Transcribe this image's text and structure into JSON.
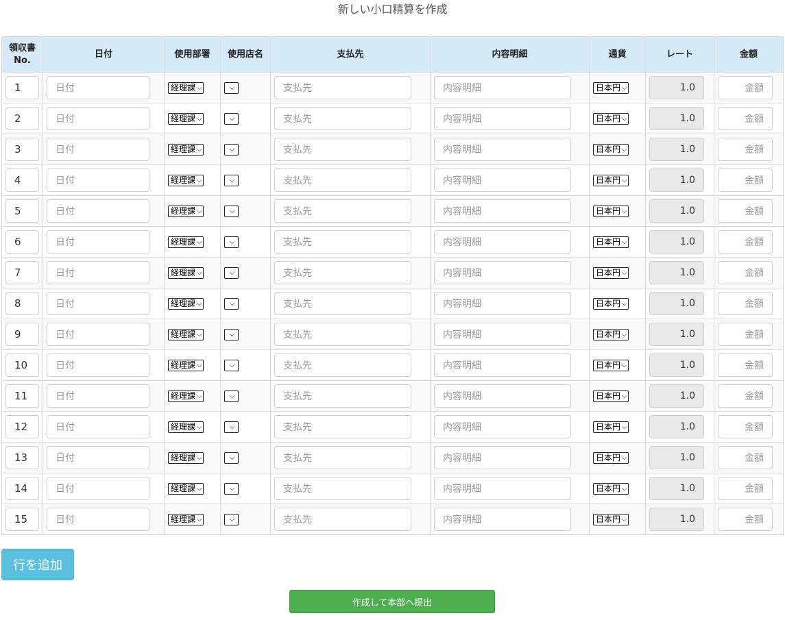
{
  "page": {
    "title": "新しい小口精算を作成"
  },
  "table": {
    "headers": {
      "receipt_no_line1": "領収書",
      "receipt_no_line2": "No.",
      "date": "日付",
      "department": "使用部署",
      "store": "使用店名",
      "payee": "支払先",
      "description": "内容明細",
      "currency": "通貨",
      "rate": "レート",
      "amount": "金額"
    },
    "placeholders": {
      "date": "日付",
      "payee": "支払先",
      "description": "内容明細",
      "amount": "金額"
    },
    "defaults": {
      "department": "経理課",
      "store": "",
      "currency": "日本円",
      "rate": "1.0"
    },
    "rows": [
      {
        "no": "1"
      },
      {
        "no": "2"
      },
      {
        "no": "3"
      },
      {
        "no": "4"
      },
      {
        "no": "5"
      },
      {
        "no": "6"
      },
      {
        "no": "7"
      },
      {
        "no": "8"
      },
      {
        "no": "9"
      },
      {
        "no": "10"
      },
      {
        "no": "11"
      },
      {
        "no": "12"
      },
      {
        "no": "13"
      },
      {
        "no": "14"
      },
      {
        "no": "15"
      }
    ]
  },
  "buttons": {
    "add_row": "行を追加",
    "submit": "作成して本部へ提出"
  },
  "icons": {
    "select_arrow": "chevron-down-icon"
  },
  "colors": {
    "header_bg": "#d6e9f6",
    "add_row_button": "#5bc0de",
    "submit_button": "#4cae4c",
    "rate_field_bg": "#e9e9e9"
  }
}
